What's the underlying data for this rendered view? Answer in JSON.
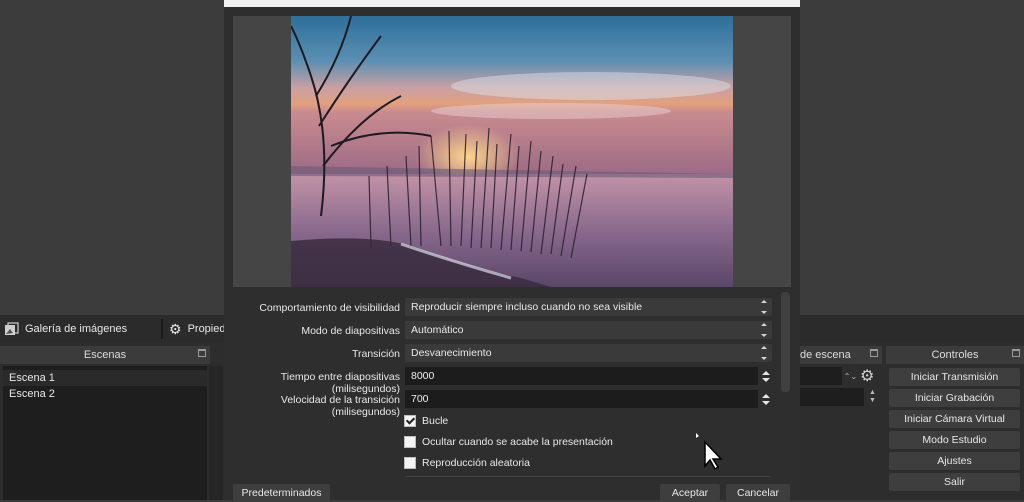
{
  "background": {
    "source_bar": {
      "source_name": "Galería de imágenes",
      "properties_label": "Propiedades"
    },
    "scenes_dock": {
      "title": "Escenas",
      "items": [
        "Escena 1",
        "Escena 2"
      ]
    },
    "transitions_dock": {
      "title": "de escena"
    },
    "controls_dock": {
      "title": "Controles",
      "buttons": [
        "Iniciar Transmisión",
        "Iniciar Grabación",
        "Iniciar Cámara Virtual",
        "Modo Estudio",
        "Ajustes",
        "Salir"
      ]
    }
  },
  "dialog": {
    "preview": {
      "image": "lake-sunset-reeds-photo"
    },
    "fields": {
      "visibility": {
        "label": "Comportamiento de visibilidad",
        "value": "Reproducir siempre incluso cuando no sea visible"
      },
      "slide_mode": {
        "label": "Modo de diapositivas",
        "value": "Automático"
      },
      "transition": {
        "label": "Transición",
        "value": "Desvanecimiento"
      },
      "slide_time": {
        "label": "Tiempo entre diapositivas (milisegundos)",
        "value": "8000"
      },
      "transition_speed": {
        "label": "Velocidad de la transición (milisegundos)",
        "value": "700"
      }
    },
    "checkboxes": {
      "loop": {
        "label": "Bucle",
        "checked": true
      },
      "hide_when_done": {
        "label": "Ocultar cuando se acabe la presentación",
        "checked": false
      },
      "random": {
        "label": "Reproducción aleatoria",
        "checked": false
      }
    },
    "buttons": {
      "defaults": "Predeterminados",
      "accept": "Aceptar",
      "cancel": "Cancelar"
    }
  },
  "colors": {
    "dialog_bg": "#2e2e2e",
    "field_bg": "#3a3a3a",
    "input_bg": "#1c1c1c",
    "button_bg": "#3e3e3e",
    "text": "#e8e8e8"
  }
}
